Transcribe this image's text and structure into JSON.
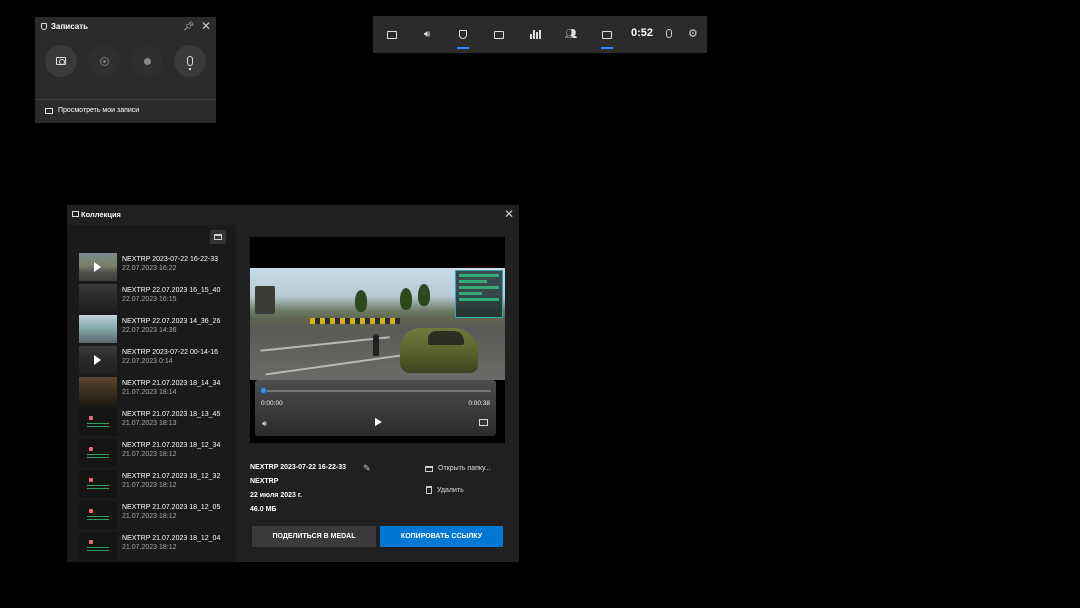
{
  "capture": {
    "title": "Записать",
    "pin_icon": "pin-icon",
    "close_icon": "close-icon",
    "view_recordings": "Просмотреть мои записи"
  },
  "gamebar": {
    "timer": "0:52",
    "items": [
      "capture-widget-icon",
      "audio-icon",
      "capture-icon",
      "performance-icon",
      "resources-icon",
      "xbox-social-icon",
      "gallery-icon"
    ],
    "active_items": [
      "capture-icon",
      "gallery-icon"
    ]
  },
  "gallery": {
    "title": "Коллекция",
    "items": [
      {
        "name": "NEXTRP 2023-07-22 16-22-33",
        "date": "22.07.2023 16:22"
      },
      {
        "name": "NEXTRP 22.07.2023 16_15_40",
        "date": "22.07.2023 16:15"
      },
      {
        "name": "NEXTRP 22.07.2023 14_36_26",
        "date": "22.07.2023 14:36"
      },
      {
        "name": "NEXTRP 2023-07-22 00-14-16",
        "date": "22.07.2023 0:14"
      },
      {
        "name": "NEXTRP 21.07.2023 18_14_34",
        "date": "21.07.2023 18:14"
      },
      {
        "name": "NEXTRP 21.07.2023 18_13_45",
        "date": "21.07.2023 18:13"
      },
      {
        "name": "NEXTRP 21.07.2023 18_12_34",
        "date": "21.07.2023 18:12"
      },
      {
        "name": "NEXTRP 21.07.2023 18_12_32",
        "date": "21.07.2023 18:12"
      },
      {
        "name": "NEXTRP 21.07.2023 18_12_05",
        "date": "21.07.2023 18:12"
      },
      {
        "name": "NEXTRP 21.07.2023 18_12_04",
        "date": "21.07.2023 18:12"
      }
    ],
    "player": {
      "current_time": "0:00:00",
      "duration": "0:00:38",
      "progress": 0.0
    },
    "details": {
      "name": "NEXTRP 2023-07-22 16-22-33",
      "game": "NEXTRP",
      "date": "22 июля 2023 г.",
      "size": "46.0 МБ"
    },
    "actions": {
      "open_folder": "Открыть папку...",
      "delete": "Удалить"
    },
    "buttons": {
      "share": "ПОДЕЛИТЬСЯ В MEDAL",
      "copy_link": "КОПИРОВАТЬ ССЫЛКУ"
    },
    "colors": {
      "accent": "#0078d4",
      "progress": "#3c8de0"
    }
  }
}
